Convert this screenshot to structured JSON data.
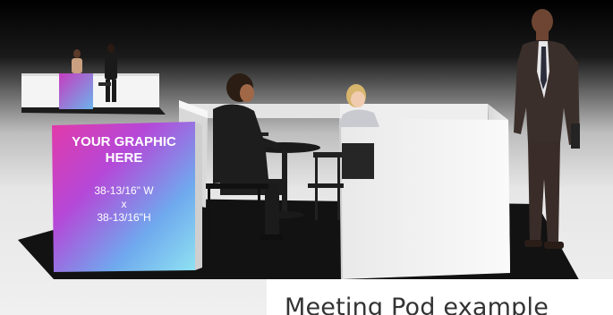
{
  "caption": "Meeting Pod example",
  "main_panel": {
    "title_line1": "YOUR GRAPHIC",
    "title_line2": "HERE",
    "dim_width": "38-13/16\" W",
    "dim_x": "x",
    "dim_height": "38-13/16\"H"
  },
  "colors": {
    "background_top": "#000000",
    "floor_carpet": "#111111",
    "wall_white": "#f2f2f2",
    "graphic_magenta": "#d63cc4",
    "graphic_cyan": "#7fd3ee"
  }
}
